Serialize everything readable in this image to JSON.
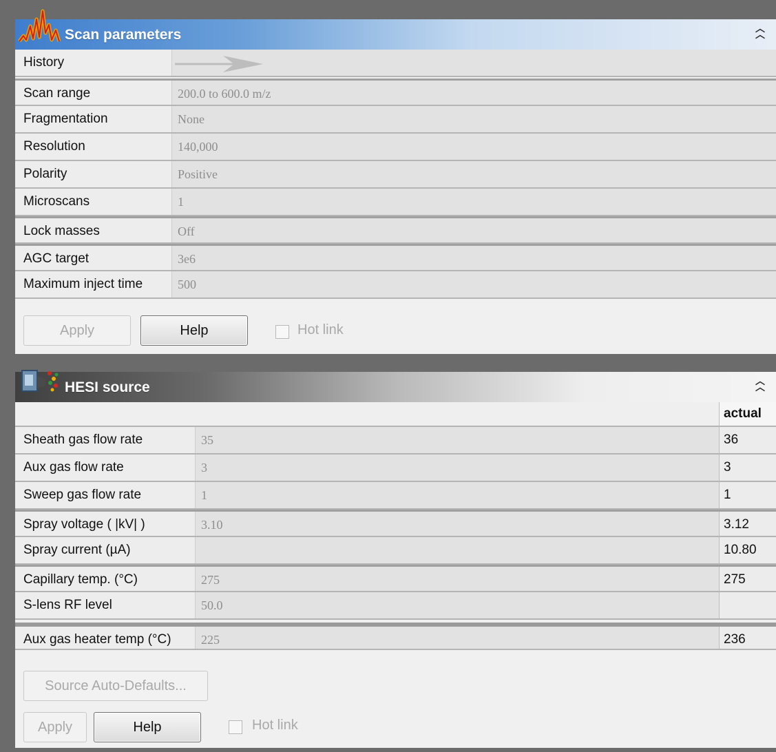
{
  "scan_panel": {
    "title": "Scan parameters",
    "history_label": "History",
    "rows": [
      {
        "label": "Scan range",
        "value": "200.0 to 600.0 m/z"
      },
      {
        "label": "Fragmentation",
        "value": "None"
      },
      {
        "label": "Resolution",
        "value": "140,000"
      },
      {
        "label": "Polarity",
        "value": "Positive"
      },
      {
        "label": "Microscans",
        "value": "1"
      },
      {
        "label": "Lock masses",
        "value": "Off"
      },
      {
        "label": "AGC target",
        "value": "3e6"
      },
      {
        "label": "Maximum inject time",
        "value": "500"
      }
    ],
    "apply_label": "Apply",
    "help_label": "Help",
    "hotlink_label": "Hot link",
    "hotlink_checked": false
  },
  "hesi_panel": {
    "title": "HESI source",
    "actual_header": "actual",
    "rows": [
      {
        "label": "Sheath gas flow rate",
        "value": "35",
        "actual": "36"
      },
      {
        "label": "Aux gas flow rate",
        "value": "3",
        "actual": "3"
      },
      {
        "label": "Sweep gas flow rate",
        "value": "1",
        "actual": "1"
      },
      {
        "label": "Spray voltage ( |kV| )",
        "value": "3.10",
        "actual": "3.12"
      },
      {
        "label": "Spray current (µA)",
        "value": "",
        "actual": "10.80"
      },
      {
        "label": "Capillary temp. (°C)",
        "value": "275",
        "actual": "275"
      },
      {
        "label": "S-lens RF level",
        "value": "50.0",
        "actual": ""
      },
      {
        "label": "Aux gas heater temp (°C)",
        "value": "225",
        "actual": "236"
      }
    ],
    "auto_defaults_label": "Source Auto-Defaults...",
    "apply_label": "Apply",
    "help_label": "Help",
    "hotlink_label": "Hot link",
    "hotlink_checked": false
  }
}
